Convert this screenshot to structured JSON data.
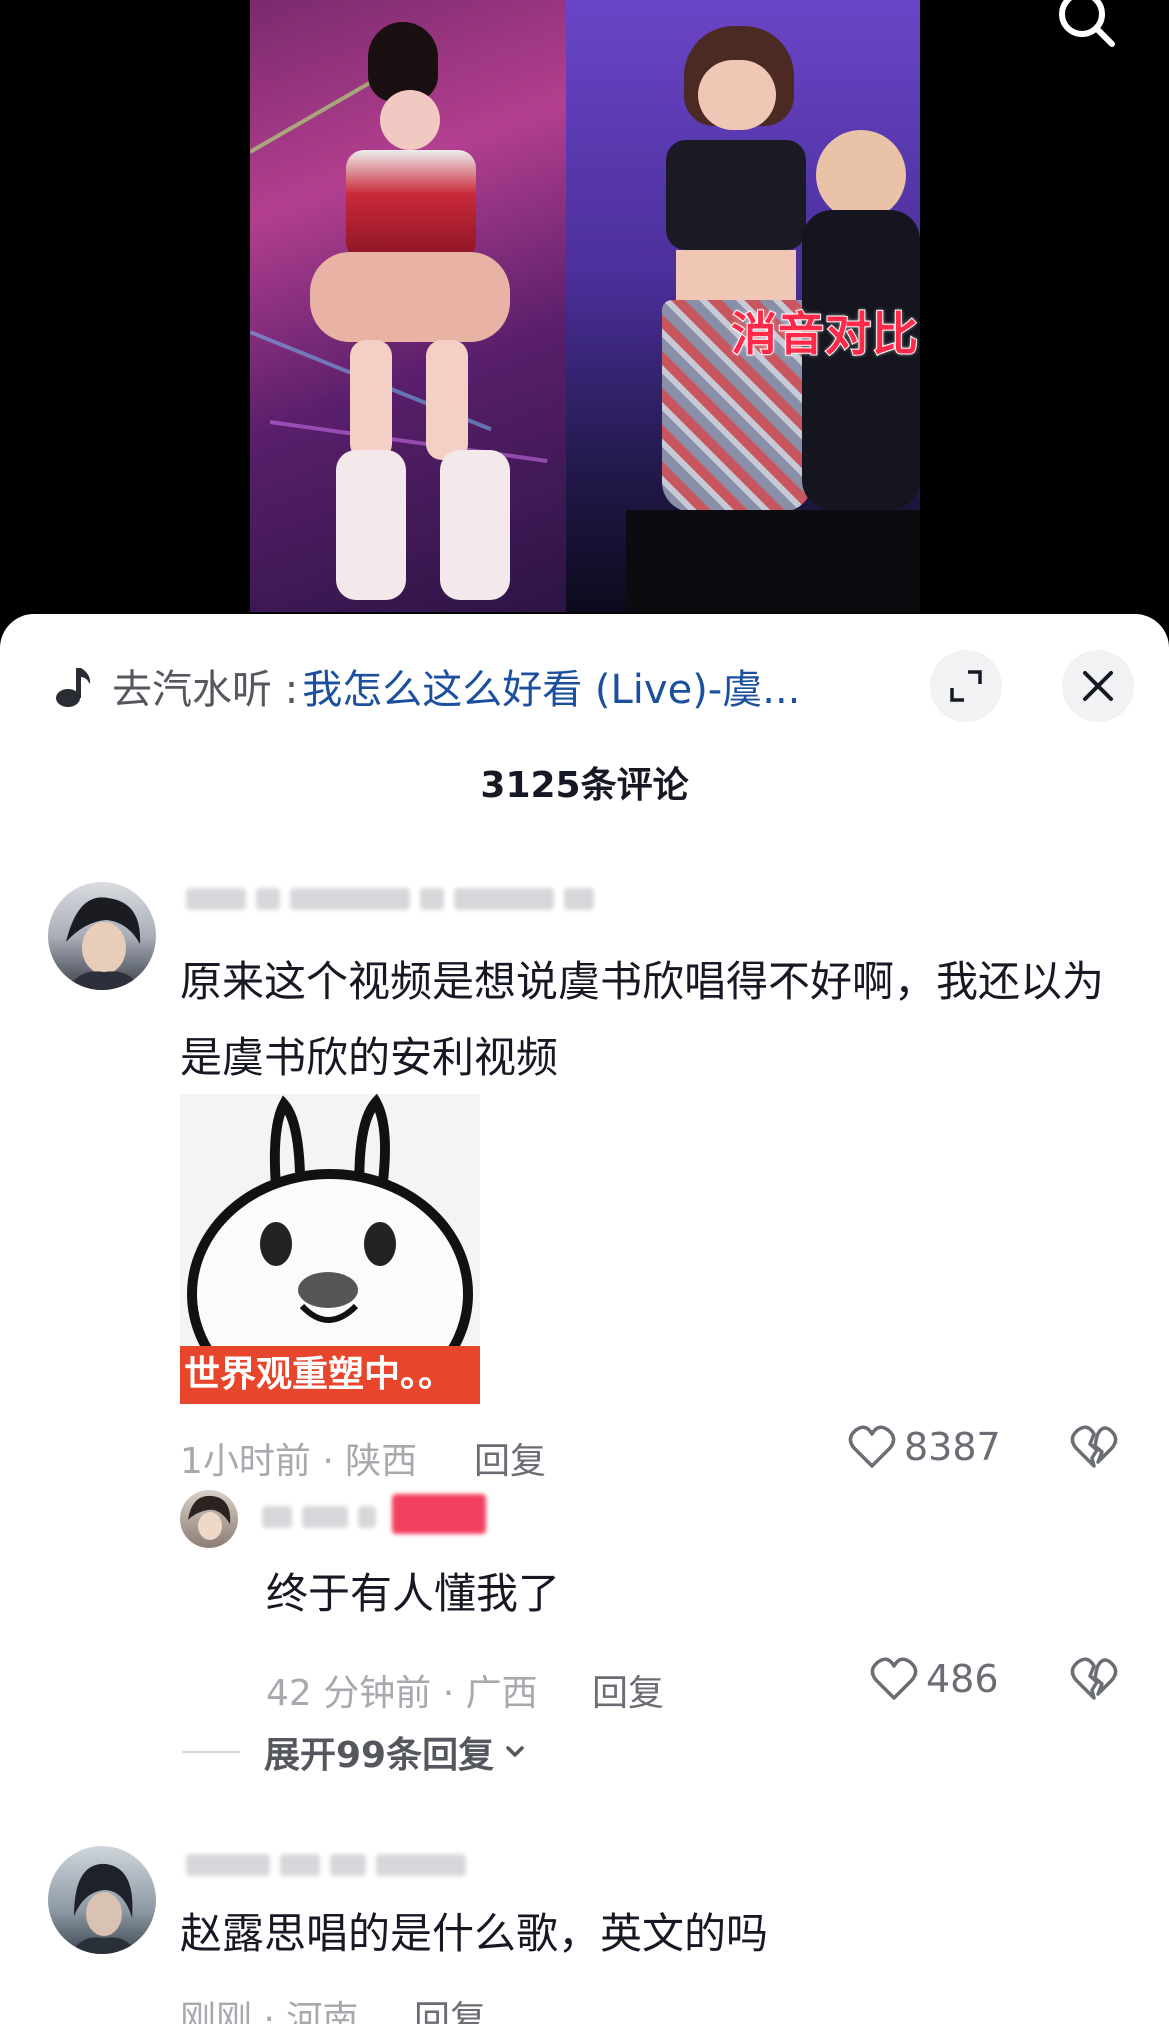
{
  "video": {
    "caption": "消音对比"
  },
  "icons": {
    "search": "search-icon",
    "music": "music-note-icon",
    "expand": "expand-icon",
    "close": "close-icon",
    "like": "heart-icon",
    "dislike": "broken-heart-icon",
    "chevron": "chevron-down-icon"
  },
  "sheet": {
    "music_prefix": "去汽水听 : ",
    "music_title": "我怎么这么好看 (Live)-虞...",
    "comment_count": "3125条评论"
  },
  "comments": [
    {
      "text": "原来这个视频是想说虞书欣唱得不好啊，我还以为是虞书欣的安利视频",
      "sticker_caption": "世界观重塑中。。",
      "meta": "1小时前 · 陕西",
      "reply_label": "回复",
      "likes": "8387"
    },
    {
      "text": "终于有人懂我了",
      "meta": "42 分钟前 · 广西",
      "reply_label": "回复",
      "likes": "486"
    },
    {
      "text": "赵露思唱的是什么歌，英文的吗",
      "meta": "刚刚 · 河南",
      "reply_label": "回复"
    }
  ],
  "expand_replies": "展开99条回复",
  "colors": {
    "link_blue": "#1c4f9e",
    "caption_red": "#ff2a4a",
    "sticker_red": "#e8462c",
    "badge_pink": "#f2405f"
  }
}
